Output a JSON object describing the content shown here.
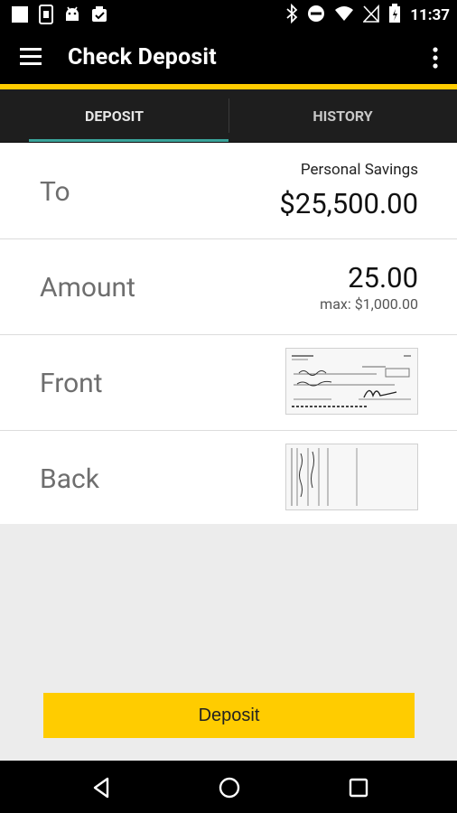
{
  "status_bar": {
    "time": "11:37",
    "left_icons": [
      "square-icon",
      "sim-card-icon",
      "android-icon",
      "checklist-icon"
    ],
    "right_icons": [
      "bluetooth-icon",
      "do-not-disturb-icon",
      "wifi-icon",
      "signal-icon",
      "battery-icon"
    ]
  },
  "app_bar": {
    "title": "Check Deposit",
    "left_icon": "hamburger-menu-icon",
    "right_icon": "overflow-menu-icon"
  },
  "tabs": [
    {
      "label": "DEPOSIT",
      "selected": true
    },
    {
      "label": "HISTORY",
      "selected": false
    }
  ],
  "form": {
    "to": {
      "label": "To",
      "account_name": "Personal Savings",
      "balance": "$25,500.00"
    },
    "amount": {
      "label": "Amount",
      "value": "25.00",
      "max_text": "max: $1,000.00"
    },
    "front": {
      "label": "Front"
    },
    "back": {
      "label": "Back"
    }
  },
  "deposit_button": {
    "label": "Deposit"
  },
  "nav_bar": {
    "icons": [
      "back-icon",
      "home-icon",
      "recent-apps-icon"
    ]
  },
  "colors": {
    "accent_yellow": "#ffcc00",
    "tab_indicator": "#3aa39a",
    "app_bar_bg": "#000000",
    "tab_bar_bg": "#1e1e1e",
    "content_bg": "#ececec"
  }
}
